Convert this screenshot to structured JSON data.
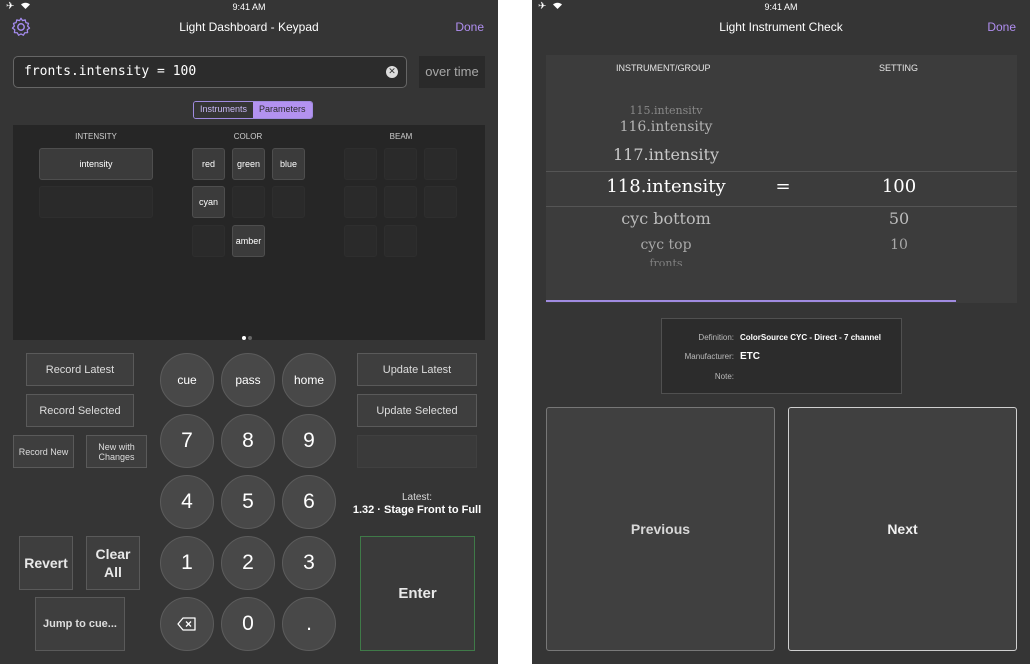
{
  "status": {
    "time": "9:41 AM"
  },
  "left": {
    "title": "Light Dashboard - Keypad",
    "done_label": "Done",
    "command": "fronts.intensity = 100",
    "over_time": "over time",
    "segments": [
      "Instruments",
      "Parameters"
    ],
    "groups": {
      "intensity": "INTENSITY",
      "color": "COLOR",
      "beam": "BEAM"
    },
    "intensity_params": [
      "intensity"
    ],
    "color_params": [
      "red",
      "green",
      "blue",
      "cyan",
      "amber"
    ],
    "record_latest": "Record Latest",
    "record_selected": "Record Selected",
    "record_new": "Record New",
    "new_with_changes": "New with Changes",
    "revert": "Revert",
    "clear_all": "Clear All",
    "jump_to_cue": "Jump to cue...",
    "update_latest": "Update Latest",
    "update_selected": "Update Selected",
    "keys": {
      "cue": "cue",
      "pass": "pass",
      "home": "home",
      "k7": "7",
      "k8": "8",
      "k9": "9",
      "k4": "4",
      "k5": "5",
      "k6": "6",
      "k1": "1",
      "k2": "2",
      "k3": "3",
      "k0": "0",
      "dot": "."
    },
    "latest_label": "Latest:",
    "latest_value": "1.32 · Stage Front to Full",
    "enter": "Enter"
  },
  "right": {
    "title": "Light Instrument Check",
    "done_label": "Done",
    "col_instrument": "INSTRUMENT/GROUP",
    "col_setting": "SETTING",
    "rows": [
      {
        "name": "115.intensity",
        "value": ""
      },
      {
        "name": "116.intensity",
        "value": ""
      },
      {
        "name": "117.intensity",
        "value": ""
      },
      {
        "name": "118.intensity",
        "value": "100"
      },
      {
        "name": "cyc bottom",
        "value": "50"
      },
      {
        "name": "cyc top",
        "value": "10"
      },
      {
        "name": "fronts",
        "value": ""
      }
    ],
    "equals": "=",
    "definition_label": "Definition:",
    "definition_value": "ColorSource CYC - Direct - 7 channel",
    "manufacturer_label": "Manufacturer:",
    "manufacturer_value": "ETC",
    "note_label": "Note:",
    "previous": "Previous",
    "next": "Next"
  },
  "colors": {
    "accent": "#b392f0",
    "background": "#353535",
    "enter_border": "#3f7a48"
  }
}
